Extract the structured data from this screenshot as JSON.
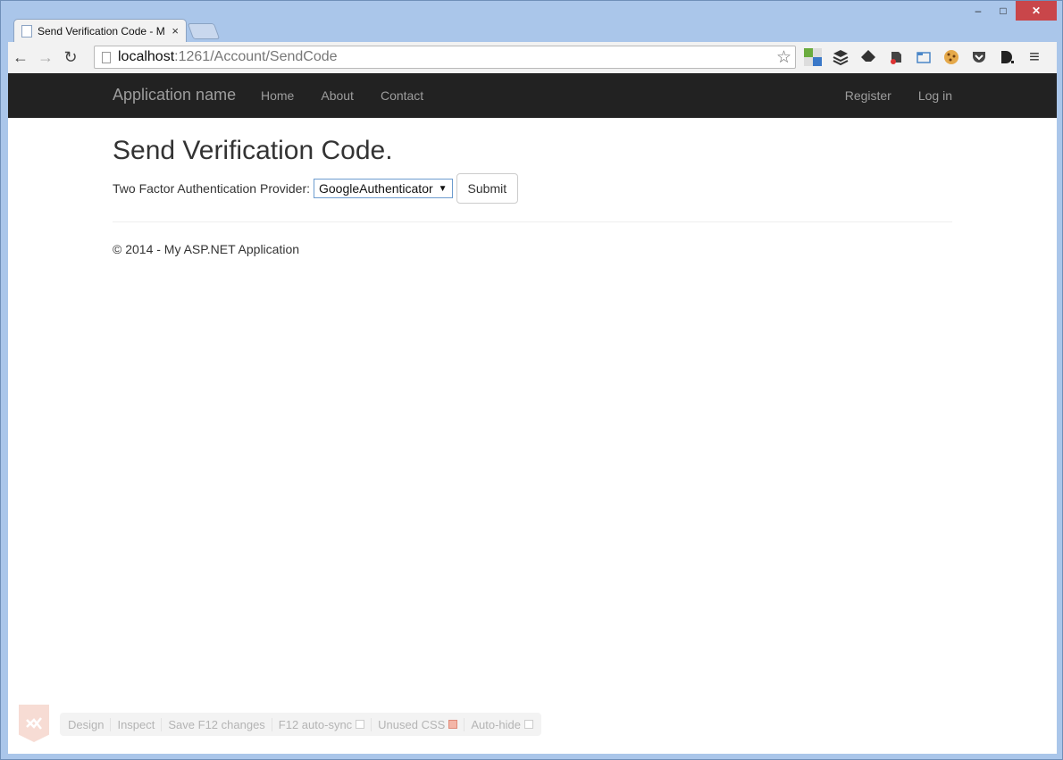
{
  "window": {
    "minimize": "–",
    "maximize": "□",
    "close": "✕"
  },
  "tab": {
    "title": "Send Verification Code - M",
    "close": "×"
  },
  "toolbar": {
    "back": "←",
    "forward": "→",
    "reload": "↻",
    "url_host": "localhost",
    "url_path": ":1261/Account/SendCode",
    "star": "☆",
    "menu": "≡"
  },
  "extensions": [
    "grid-icon",
    "buffer-icon",
    "feedly-icon",
    "evernote-icon",
    "folder-icon",
    "cookie-icon",
    "pocket-icon",
    "dashlane-icon"
  ],
  "navbar": {
    "brand": "Application name",
    "links": [
      "Home",
      "About",
      "Contact"
    ],
    "right_links": [
      "Register",
      "Log in"
    ]
  },
  "main": {
    "title": "Send Verification Code.",
    "provider_label": "Two Factor Authentication Provider:",
    "provider_value": "GoogleAuthenticator",
    "submit_label": "Submit",
    "footer": "© 2014 - My ASP.NET Application"
  },
  "browser_link": {
    "items": [
      "Design",
      "Inspect",
      "Save F12 changes",
      "F12 auto-sync",
      "Unused CSS",
      "Auto-hide"
    ],
    "f12_auto_sync_checked": false,
    "unused_css_checked": true,
    "auto_hide_checked": false
  }
}
